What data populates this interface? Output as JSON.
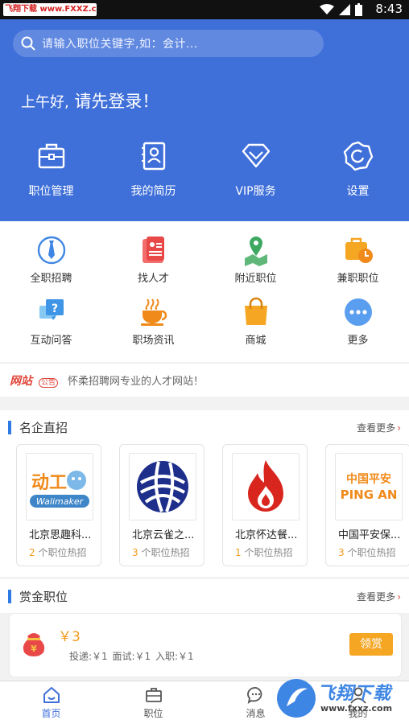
{
  "status_bar": {
    "watermark": "飞翔下载 www.FXXZ.com",
    "time": "8:43"
  },
  "header": {
    "search_placeholder": "请输入职位关键字,如：会计...",
    "greeting_prefix": "上午好,",
    "greeting_main": " 请先登录！",
    "menu": [
      {
        "label": "职位管理",
        "icon": "briefcase-icon"
      },
      {
        "label": "我的简历",
        "icon": "resume-icon"
      },
      {
        "label": "VIP服务",
        "icon": "diamond-icon"
      },
      {
        "label": "设置",
        "icon": "gear-icon"
      }
    ]
  },
  "grid": [
    {
      "label": "全职招聘",
      "icon": "tie-icon"
    },
    {
      "label": "找人才",
      "icon": "id-card-icon"
    },
    {
      "label": "附近职位",
      "icon": "location-pin-icon"
    },
    {
      "label": "兼职职位",
      "icon": "part-time-clock-icon"
    },
    {
      "label": "互动问答",
      "icon": "qa-bubble-icon"
    },
    {
      "label": "职场资讯",
      "icon": "coffee-icon"
    },
    {
      "label": "商城",
      "icon": "shopping-bag-icon"
    },
    {
      "label": "更多",
      "icon": "more-dots-icon"
    }
  ],
  "notice": {
    "badge_main": "网站",
    "badge_sub": "公告",
    "text": "怀柔招聘网专业的人才网站！"
  },
  "famous_companies": {
    "title": "名企直招",
    "more": "查看更多",
    "items": [
      {
        "name": "北京思趣科...",
        "count": "2",
        "suffix": " 个职位热招",
        "logo_text": "Walimaker"
      },
      {
        "name": "北京云雀之...",
        "count": "3",
        "suffix": " 个职位热招",
        "logo_text": ""
      },
      {
        "name": "北京怀达餐...",
        "count": "1",
        "suffix": " 个职位热招",
        "logo_text": ""
      },
      {
        "name": "中国平安保...",
        "count": "3",
        "suffix": " 个职位热招",
        "logo_text": "中国平安",
        "logo_sub": "PING AN"
      }
    ]
  },
  "reward_jobs": {
    "title": "赏金职位",
    "more": "查看更多",
    "card": {
      "amount": "￥3",
      "detail": "投递:￥1    面试:￥1    入职:￥1",
      "claim_label": "领赏"
    }
  },
  "bottom_nav": [
    {
      "label": "首页",
      "icon": "home-icon",
      "active": true
    },
    {
      "label": "职位",
      "icon": "briefcase-icon",
      "active": false
    },
    {
      "label": "消息",
      "icon": "message-icon",
      "active": false
    },
    {
      "label": "我的",
      "icon": "user-icon",
      "active": false
    }
  ],
  "watermark_bottom": {
    "text": "飞翔下载",
    "url": "www.fxxz.com"
  },
  "colors": {
    "primary": "#3f6fd9",
    "accent": "#f39a1e",
    "red": "#e0463b"
  }
}
